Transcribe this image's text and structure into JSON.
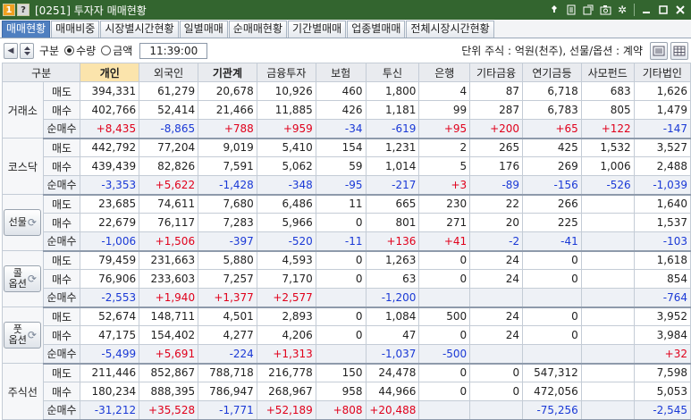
{
  "window": {
    "badge": "1",
    "help": "?",
    "title": "[0251] 투자자 매매현황"
  },
  "titlebar_icons": [
    "pin-icon",
    "doc-icon",
    "popup-icon",
    "camera-icon",
    "gear-icon",
    "minimize-icon",
    "maximize-icon",
    "close-icon"
  ],
  "tabs": [
    "매매현황",
    "매매비중",
    "시장별시간현황",
    "일별매매",
    "순매매현황",
    "기간별매매",
    "업종별매매",
    "전체시장시간현황"
  ],
  "active_tab": 0,
  "toolbar": {
    "gubun_label": "구분",
    "radio_qty": "수량",
    "radio_amt": "금액",
    "time": "11:39:00",
    "unit_label": "단위 주식 : 억원(천주), 선물/옵션 : 계약"
  },
  "columns": [
    "구분",
    "개인",
    "외국인",
    "기관계",
    "금융투자",
    "보험",
    "투신",
    "은행",
    "기타금융",
    "연기금등",
    "사모펀드",
    "기타법인"
  ],
  "groups": [
    {
      "label": "거래소",
      "button": false,
      "rows": [
        {
          "label": "매도",
          "values": [
            "394,331",
            "61,279",
            "20,678",
            "10,926",
            "460",
            "1,800",
            "4",
            "87",
            "6,718",
            "683",
            "1,626"
          ]
        },
        {
          "label": "매수",
          "values": [
            "402,766",
            "52,414",
            "21,466",
            "11,885",
            "426",
            "1,181",
            "99",
            "287",
            "6,783",
            "805",
            "1,479"
          ]
        },
        {
          "label": "순매수",
          "values": [
            "+8,435",
            "-8,865",
            "+788",
            "+959",
            "-34",
            "-619",
            "+95",
            "+200",
            "+65",
            "+122",
            "-147"
          ]
        }
      ]
    },
    {
      "label": "코스닥",
      "button": false,
      "rows": [
        {
          "label": "매도",
          "values": [
            "442,792",
            "77,204",
            "9,019",
            "5,410",
            "154",
            "1,231",
            "2",
            "265",
            "425",
            "1,532",
            "3,527"
          ]
        },
        {
          "label": "매수",
          "values": [
            "439,439",
            "82,826",
            "7,591",
            "5,062",
            "59",
            "1,014",
            "5",
            "176",
            "269",
            "1,006",
            "2,488"
          ]
        },
        {
          "label": "순매수",
          "values": [
            "-3,353",
            "+5,622",
            "-1,428",
            "-348",
            "-95",
            "-217",
            "+3",
            "-89",
            "-156",
            "-526",
            "-1,039"
          ]
        }
      ]
    },
    {
      "label": "선물",
      "button": true,
      "rows": [
        {
          "label": "매도",
          "values": [
            "23,685",
            "74,611",
            "7,680",
            "6,486",
            "11",
            "665",
            "230",
            "22",
            "266",
            "",
            "1,640"
          ]
        },
        {
          "label": "매수",
          "values": [
            "22,679",
            "76,117",
            "7,283",
            "5,966",
            "0",
            "801",
            "271",
            "20",
            "225",
            "",
            "1,537"
          ]
        },
        {
          "label": "순매수",
          "values": [
            "-1,006",
            "+1,506",
            "-397",
            "-520",
            "-11",
            "+136",
            "+41",
            "-2",
            "-41",
            "",
            "-103"
          ]
        }
      ]
    },
    {
      "label": "콜옵션",
      "label_lines": [
        "콜",
        "옵션"
      ],
      "button": true,
      "rows": [
        {
          "label": "매도",
          "values": [
            "79,459",
            "231,663",
            "5,880",
            "4,593",
            "0",
            "1,263",
            "0",
            "24",
            "0",
            "",
            "1,618"
          ]
        },
        {
          "label": "매수",
          "values": [
            "76,906",
            "233,603",
            "7,257",
            "7,170",
            "0",
            "63",
            "0",
            "24",
            "0",
            "",
            "854"
          ]
        },
        {
          "label": "순매수",
          "values": [
            "-2,553",
            "+1,940",
            "+1,377",
            "+2,577",
            "",
            "-1,200",
            "",
            "",
            "",
            "",
            "-764"
          ]
        }
      ]
    },
    {
      "label": "풋옵션",
      "label_lines": [
        "풋",
        "옵션"
      ],
      "button": true,
      "rows": [
        {
          "label": "매도",
          "values": [
            "52,674",
            "148,711",
            "4,501",
            "2,893",
            "0",
            "1,084",
            "500",
            "24",
            "0",
            "",
            "3,952"
          ]
        },
        {
          "label": "매수",
          "values": [
            "47,175",
            "154,402",
            "4,277",
            "4,206",
            "0",
            "47",
            "0",
            "24",
            "0",
            "",
            "3,984"
          ]
        },
        {
          "label": "순매수",
          "values": [
            "-5,499",
            "+5,691",
            "-224",
            "+1,313",
            "",
            "-1,037",
            "-500",
            "",
            "",
            "",
            "+32"
          ]
        }
      ]
    },
    {
      "label": "주식선",
      "button": false,
      "rows": [
        {
          "label": "매도",
          "values": [
            "211,446",
            "852,867",
            "788,718",
            "216,778",
            "150",
            "24,478",
            "0",
            "0",
            "547,312",
            "",
            "7,598"
          ]
        },
        {
          "label": "매수",
          "values": [
            "180,234",
            "888,395",
            "786,947",
            "268,967",
            "958",
            "44,966",
            "0",
            "0",
            "472,056",
            "",
            "5,053"
          ]
        },
        {
          "label": "순매수",
          "values": [
            "-31,212",
            "+35,528",
            "-1,771",
            "+52,189",
            "+808",
            "+20,488",
            "",
            "",
            "-75,256",
            "",
            "-2,545"
          ]
        }
      ]
    }
  ],
  "colors": {
    "titlebar": "#33652f",
    "active_tab": "#4f7fc0",
    "highlight_header": "#fbe4ac",
    "positive": "#e0001b",
    "negative": "#1a39d6"
  }
}
